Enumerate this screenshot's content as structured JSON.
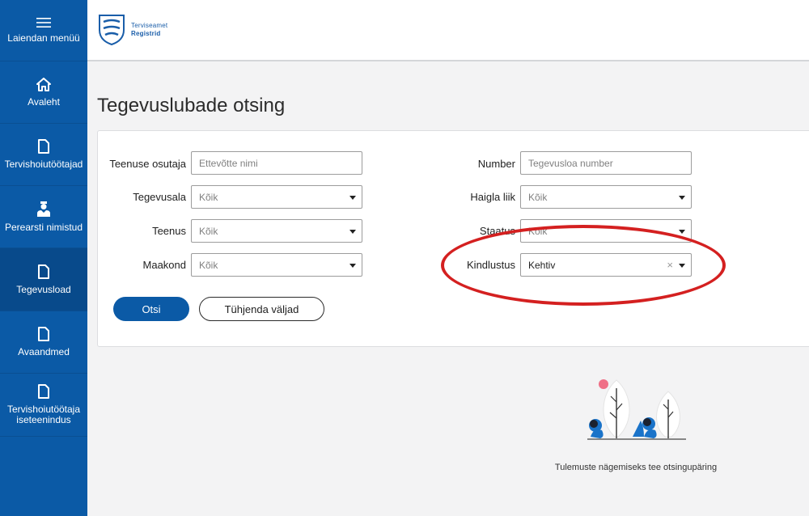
{
  "sidebar": {
    "items": [
      {
        "label": "Laiendan menüü",
        "icon": "hamburger-icon"
      },
      {
        "label": "Avaleht",
        "icon": "home-icon"
      },
      {
        "label": "Tervishoiutöötajad",
        "icon": "document-icon"
      },
      {
        "label": "Perearsti nimistud",
        "icon": "doctor-icon"
      },
      {
        "label": "Tegevusload",
        "icon": "document-icon",
        "active": true
      },
      {
        "label": "Avaandmed",
        "icon": "document-icon"
      },
      {
        "label": "Tervishoiutöötaja iseteenindus",
        "icon": "document-icon"
      }
    ]
  },
  "header": {
    "logo_line1": "Terviseamet",
    "logo_line2": "Registrid"
  },
  "page": {
    "title": "Tegevuslubade otsing"
  },
  "form": {
    "provider": {
      "label": "Teenuse osutaja",
      "placeholder": "Ettevõtte nimi"
    },
    "field_of_activity": {
      "label": "Tegevusala",
      "value": "Kõik"
    },
    "service": {
      "label": "Teenus",
      "value": "Kõik"
    },
    "county": {
      "label": "Maakond",
      "value": "Kõik"
    },
    "number": {
      "label": "Number",
      "placeholder": "Tegevusloa number"
    },
    "hospital_type": {
      "label": "Haigla liik",
      "value": "Kõik"
    },
    "status": {
      "label": "Staatus",
      "value": "Kõik"
    },
    "validity": {
      "label": "Kindlustus",
      "value": "Kehtiv"
    },
    "search_button": "Otsi",
    "clear_button": "Tühjenda väljad"
  },
  "results": {
    "empty_message": "Tulemuste nägemiseks tee otsingupäring"
  },
  "colors": {
    "primary": "#0b5aa6",
    "annotation": "#d42020"
  }
}
